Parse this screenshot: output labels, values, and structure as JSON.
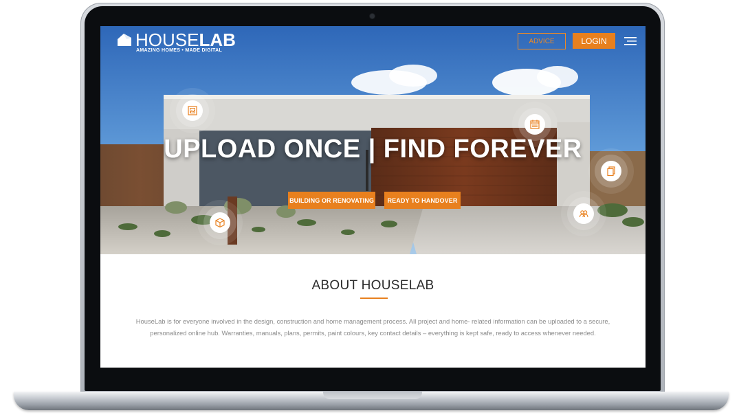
{
  "brand": {
    "name_light": "HOUSE",
    "name_bold": "LAB",
    "tagline": "AMAZING HOMES • MADE DIGITAL"
  },
  "nav": {
    "advice_label": "ADVICE",
    "login_label": "LOGIN",
    "menu_icon": "hamburger-menu-icon"
  },
  "hero": {
    "headline": "UPLOAD ONCE | FIND FOREVER",
    "cta_primary": "BUILDING OR RENOVATING",
    "cta_secondary": "READY TO HANDOVER",
    "feature_icons": [
      "gallery-icon",
      "calendar-icon",
      "documents-icon",
      "package-icon",
      "people-icon"
    ]
  },
  "about": {
    "title": "ABOUT HOUSELAB",
    "body": "HouseLab is for everyone involved in the design, construction and home management process. All project and home- related information can be uploaded to a secure, personalized online hub. Warranties, manuals, plans, permits, paint colours, key contact details – everything is kept safe, ready to access whenever needed."
  },
  "colors": {
    "accent": "#e8801e",
    "text_dark": "#2a2a2a",
    "text_muted": "#8a8a8a"
  }
}
